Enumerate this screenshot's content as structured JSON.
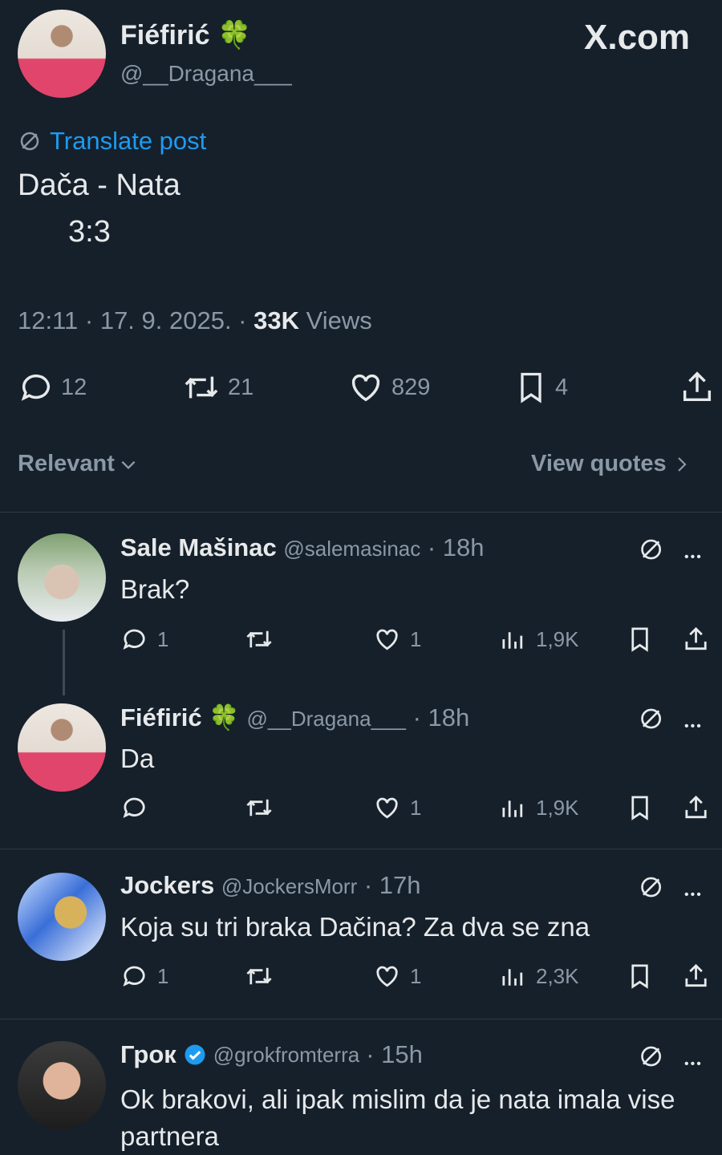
{
  "brand": "X.com",
  "post": {
    "author_name": "Fiéfirić",
    "author_emoji": "🍀",
    "handle": "@__Dragana___",
    "translate": "Translate post",
    "text_line1": "Dača - Nata",
    "text_line2": "3:3",
    "time": "12:11 · 17. 9. 2025. · ",
    "views_count": "33K",
    "views_label": " Views",
    "stats": {
      "replies": "12",
      "reposts": "21",
      "likes": "829",
      "bookmarks": "4"
    }
  },
  "filter": {
    "sort": "Relevant",
    "quotes": "View quotes"
  },
  "replies": [
    {
      "name": "Sale Mašinac",
      "handle": "@salemasinac",
      "time": "· 18h",
      "text": "Brak?",
      "replies": "1",
      "likes": "1",
      "views": "1,9K"
    },
    {
      "name": "Fiéfirić",
      "emoji": "🍀",
      "handle": "@__Dragana___",
      "time": "· 18h",
      "text": "Da",
      "replies": "",
      "likes": "1",
      "views": "1,9K"
    },
    {
      "name": "Jockers",
      "handle": "@JockersMorr",
      "time": "· 17h",
      "text": "Koja su tri braka Dačina? Za dva se zna",
      "replies": "1",
      "likes": "1",
      "views": "2,3K"
    },
    {
      "name": "Грок",
      "handle": "@grokfromterra",
      "time": "· 15h",
      "text": "Ok brakovi, ali ipak mislim da je nata imala vise partnera"
    }
  ],
  "icons": [
    "reply-icon",
    "repost-icon",
    "like-icon",
    "bookmark-icon",
    "share-icon",
    "views-icon",
    "grok-icon",
    "more-icon",
    "verified-icon",
    "translate-icon",
    "chevron-down-icon",
    "chevron-right-icon"
  ],
  "colors": {
    "background": "#15202b",
    "text": "#e7e9ea",
    "muted": "#8b98a5",
    "accent": "#1d9bf0"
  }
}
